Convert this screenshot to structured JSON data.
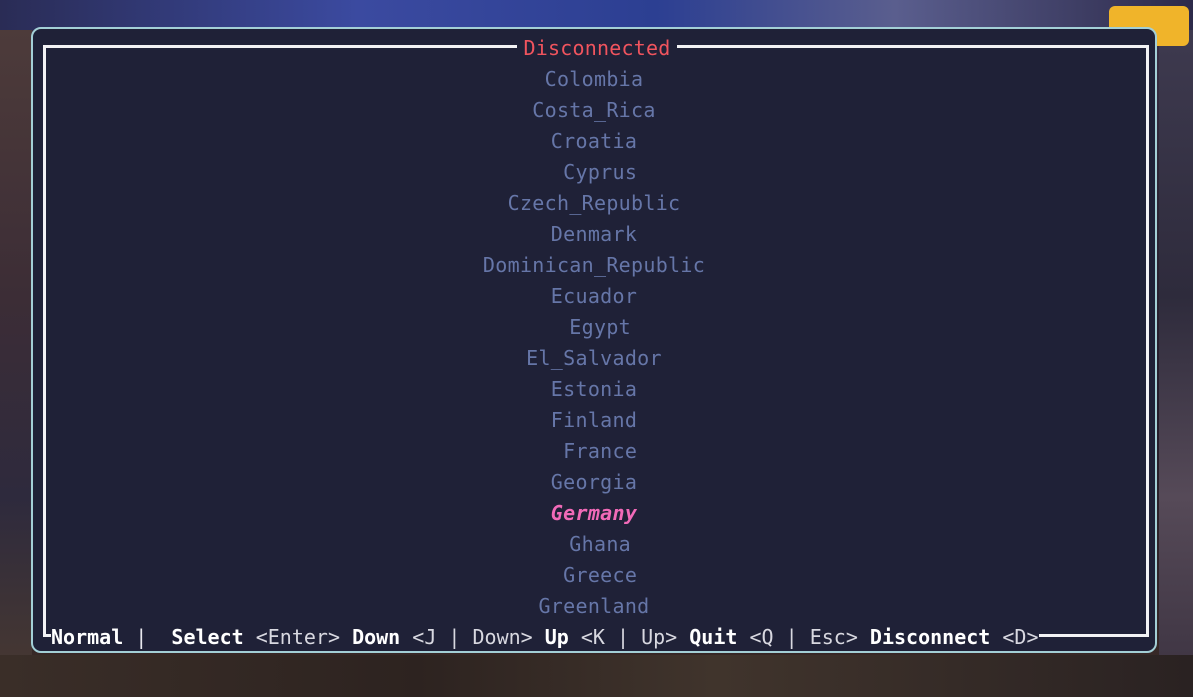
{
  "window": {
    "title": "Disconnected",
    "title_color": "#f0545e",
    "border_color": "#a3cfd6",
    "background": "#1f2137"
  },
  "countries": [
    "Colombia",
    "Costa_Rica",
    "Croatia",
    " Cyprus",
    "Czech_Republic",
    "Denmark",
    "Dominican_Republic",
    "Ecuador",
    " Egypt",
    "El_Salvador",
    "Estonia",
    "Finland",
    " France",
    "Georgia",
    "Germany",
    " Ghana",
    " Greece",
    "Greenland"
  ],
  "selected_country": "Germany",
  "colors": {
    "list_text": "#6676a8",
    "selected_text": "#f16ab8"
  },
  "statusbar": {
    "mode": "Normal",
    "sep": " | ",
    "select_label": "Select",
    "select_key": "<Enter>",
    "down_label": "Down",
    "down_key": "<J | Down>",
    "up_label": "Up",
    "up_key": "<K | Up>",
    "quit_label": "Quit",
    "quit_key": "<Q | Esc>",
    "disconnect_label": "Disconnect",
    "disconnect_key": "<D>"
  }
}
